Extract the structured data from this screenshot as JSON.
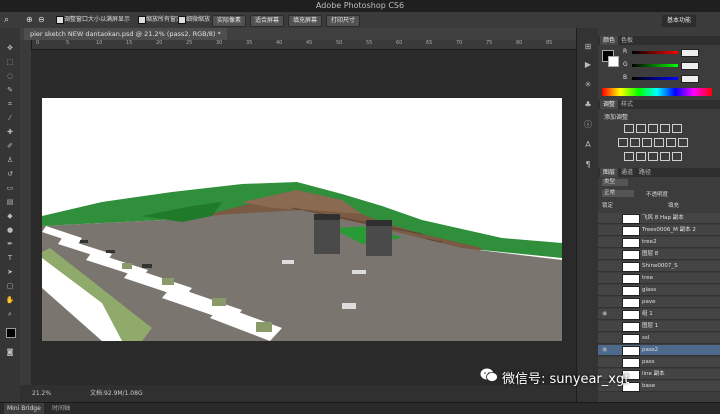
{
  "window": {
    "title": "Adobe Photoshop CS6"
  },
  "options_bar": {
    "check_resize_label": "调整窗口大小以满屏显示",
    "check_zoom_all_label": "缩放所有窗口",
    "check_scrubby_label": "细微缩放",
    "btn_actual_pixels": "实际像素",
    "btn_fit_screen": "适合屏幕",
    "btn_fill_screen": "填充屏幕",
    "btn_print_size": "打印尺寸",
    "workspace": "基本功能"
  },
  "document": {
    "tab_label": "pier sketch NEW dantaokan.psd @ 21.2% (pass2, RGB/8) *",
    "ruler_ticks": [
      "0",
      "5",
      "10",
      "15",
      "20",
      "25",
      "30",
      "35",
      "40",
      "45",
      "50",
      "55",
      "60",
      "65",
      "70",
      "75",
      "80",
      "85",
      "90"
    ]
  },
  "status": {
    "zoom": "21.2%",
    "doc_info": "文档:92.9M/1.08G"
  },
  "bottom_tabs": {
    "mini_bridge": "Mini Bridge",
    "timeline": "时间轴"
  },
  "color_panel": {
    "tabs": [
      "颜色",
      "色板"
    ],
    "labels": [
      "R",
      "G",
      "B"
    ]
  },
  "adjust_panel": {
    "tabs": [
      "调整",
      "样式"
    ],
    "title": "添加调整"
  },
  "layers_panel": {
    "tabs": [
      "图层",
      "通道",
      "路径"
    ],
    "kind_label": "类型",
    "mode": "正常",
    "opacity_label": "不透明度",
    "lock_label": "锁定",
    "fill_label": "填充",
    "layers": [
      {
        "name": "飞风 8 Hap 副本",
        "selected": false,
        "eye": false
      },
      {
        "name": "Trees0006_M 副本 2",
        "selected": false,
        "eye": false
      },
      {
        "name": "tree2",
        "selected": false,
        "eye": false
      },
      {
        "name": "图层 8",
        "selected": false,
        "eye": false
      },
      {
        "name": "Shine0007_S",
        "selected": false,
        "eye": false
      },
      {
        "name": "tree",
        "selected": false,
        "eye": false
      },
      {
        "name": "glass",
        "selected": false,
        "eye": false
      },
      {
        "name": "pave",
        "selected": false,
        "eye": false
      },
      {
        "name": "组 1",
        "selected": false,
        "eye": true
      },
      {
        "name": "图层 1",
        "selected": false,
        "eye": false
      },
      {
        "name": "ssl",
        "selected": false,
        "eye": false
      },
      {
        "name": "pass2",
        "selected": true,
        "eye": true
      },
      {
        "name": "pass",
        "selected": false,
        "eye": false
      },
      {
        "name": "line 副本",
        "selected": false,
        "eye": false
      },
      {
        "name": "base",
        "selected": false,
        "eye": false
      }
    ]
  },
  "watermark": {
    "text": "微信号: sunyear_xgt"
  },
  "colors": {
    "accent_selection": "#4d6a8c",
    "grass": "#2f8f3a",
    "wood": "#7a5a42",
    "deck": "#7a756f"
  }
}
